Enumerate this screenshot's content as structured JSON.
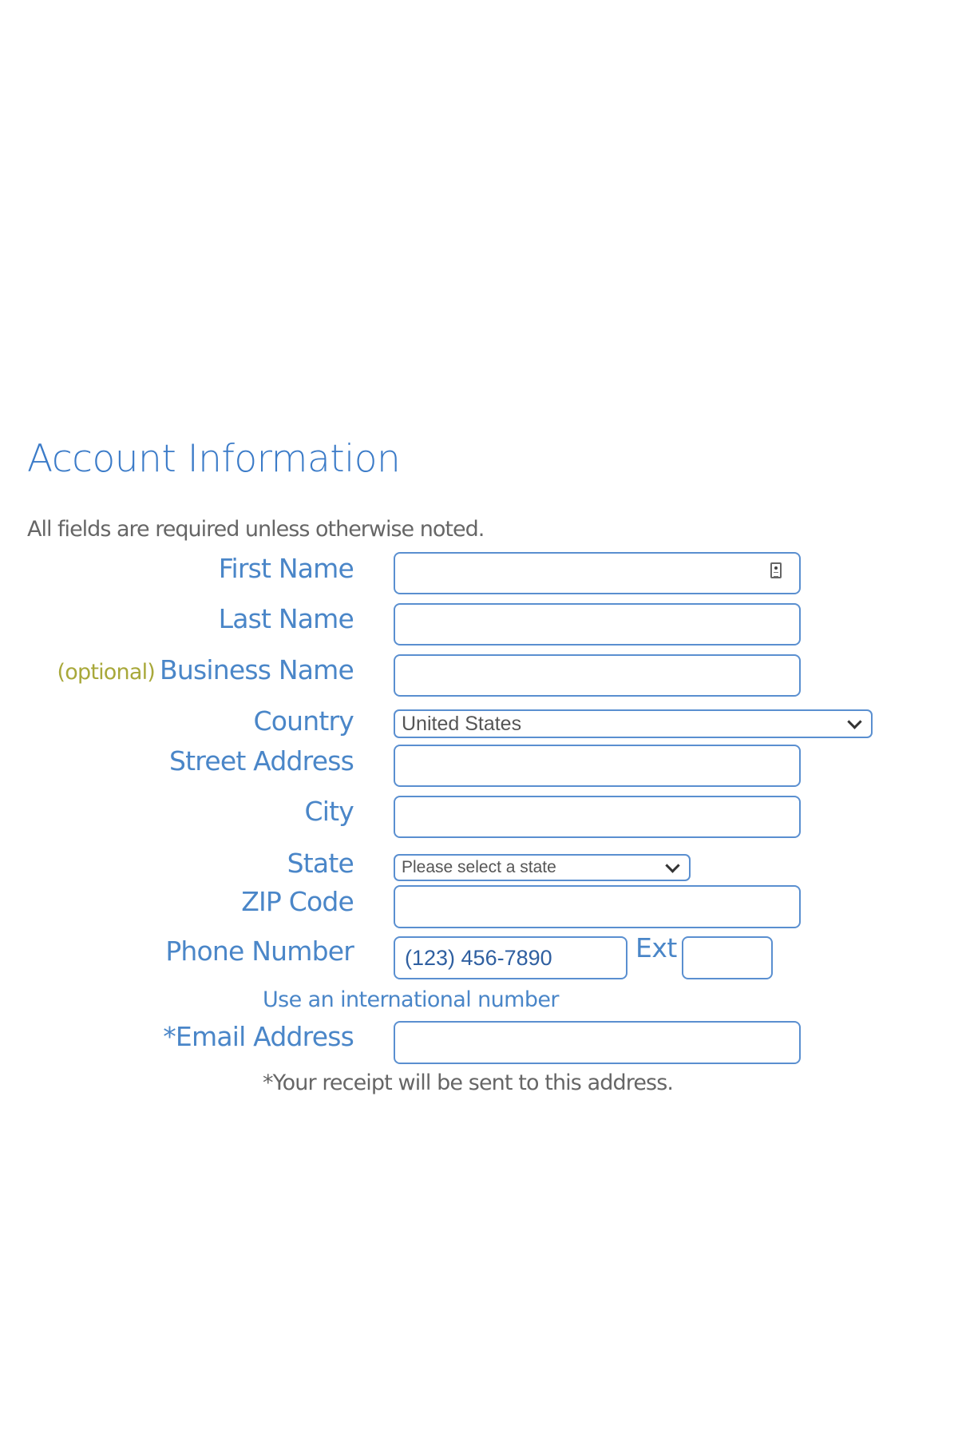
{
  "section": {
    "title": "Account Information",
    "required_note": "All fields are required unless otherwise noted."
  },
  "fields": {
    "first_name": {
      "label": "First Name",
      "value": ""
    },
    "last_name": {
      "label": "Last Name",
      "value": ""
    },
    "business_name": {
      "optional_tag": "(optional)",
      "label": "Business Name",
      "value": ""
    },
    "country": {
      "label": "Country",
      "selected": "United States"
    },
    "street_address": {
      "label": "Street Address",
      "value": ""
    },
    "city": {
      "label": "City",
      "value": ""
    },
    "state": {
      "label": "State",
      "selected": "Please select a state"
    },
    "zip": {
      "label": "ZIP Code",
      "value": ""
    },
    "phone": {
      "label": "Phone Number",
      "placeholder": "(123) 456-7890",
      "ext_label": "Ext",
      "ext_value": ""
    },
    "international_link": "Use an international number",
    "email": {
      "label": "*Email Address",
      "value": ""
    },
    "email_note": "*Your receipt will be sent to this address."
  },
  "icons": {
    "first_name_autofill": "contact-card-icon"
  },
  "colors": {
    "accent": "#4a86c8",
    "title": "#3b7bc8",
    "input_border": "#5a8fd0",
    "optional": "#a8a83a",
    "muted_text": "#666666"
  }
}
